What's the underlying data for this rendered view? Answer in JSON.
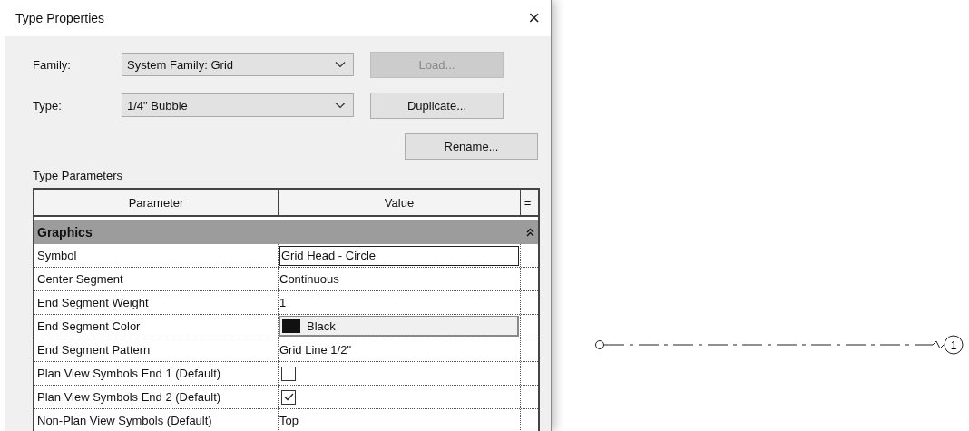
{
  "window": {
    "title": "Type Properties",
    "close": "×"
  },
  "fields": [
    {
      "label": "Family:",
      "value": "System Family: Grid",
      "button": {
        "label": "Load...",
        "disabled": true
      }
    },
    {
      "label": "Type:",
      "value": "1/4\" Bubble",
      "button": {
        "label": "Duplicate...",
        "disabled": false
      }
    }
  ],
  "extra_button": {
    "label": "Rename...",
    "disabled": false
  },
  "section_label": "Type Parameters",
  "table": {
    "columns": [
      "Parameter",
      "Value",
      "="
    ],
    "group": {
      "label": "Graphics",
      "expanded": true
    },
    "rows": [
      {
        "name": "Symbol",
        "kind": "edit",
        "value": "Grid Head - Circle"
      },
      {
        "name": "Center Segment",
        "kind": "text",
        "value": "Continuous"
      },
      {
        "name": "End Segment Weight",
        "kind": "text",
        "value": "1"
      },
      {
        "name": "End Segment Color",
        "kind": "color",
        "value": "Black",
        "color": "#111111"
      },
      {
        "name": "End Segment Pattern",
        "kind": "text",
        "value": "Grid Line 1/2\""
      },
      {
        "name": "Plan View Symbols End 1 (Default)",
        "kind": "check",
        "checked": false
      },
      {
        "name": "Plan View Symbols End 2 (Default)",
        "kind": "check",
        "checked": true
      },
      {
        "name": "Non-Plan View Symbols (Default)",
        "kind": "text",
        "value": "Top"
      }
    ]
  },
  "grid_line": {
    "label": "1"
  }
}
